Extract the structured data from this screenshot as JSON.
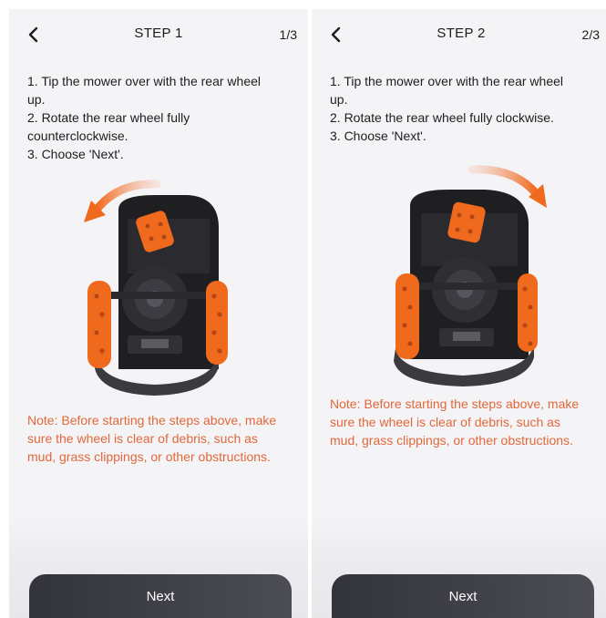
{
  "screens": [
    {
      "title": "STEP 1",
      "page": "1/3",
      "instructions": [
        "1. Tip the mower over with the rear wheel",
        "up.",
        "2. Rotate the rear wheel fully",
        "counterclockwise.",
        "3. Choose 'Next'."
      ],
      "note_lines": [
        "Note: Before starting the steps above, make",
        "sure the wheel is clear of debris, such as",
        "mud, grass clippings, or other obstructions."
      ],
      "rotation_arrow": "counterclockwise-arrow-icon",
      "next_label": "Next"
    },
    {
      "title": "STEP 2",
      "page": "2/3",
      "instructions": [
        "1. Tip the mower over with the rear wheel",
        "up.",
        "2. Rotate the rear wheel fully clockwise.",
        "3. Choose 'Next'."
      ],
      "note_lines": [
        "Note: Before starting the steps above, make",
        "sure the wheel is clear of debris, such as",
        "mud, grass clippings, or other obstructions."
      ],
      "rotation_arrow": "clockwise-arrow-icon",
      "next_label": "Next"
    }
  ],
  "colors": {
    "accent_orange": "#e2673a",
    "wheel_orange": "#f06a1e",
    "button_dark": "#3a3a42",
    "background": "#f4f4f6"
  }
}
